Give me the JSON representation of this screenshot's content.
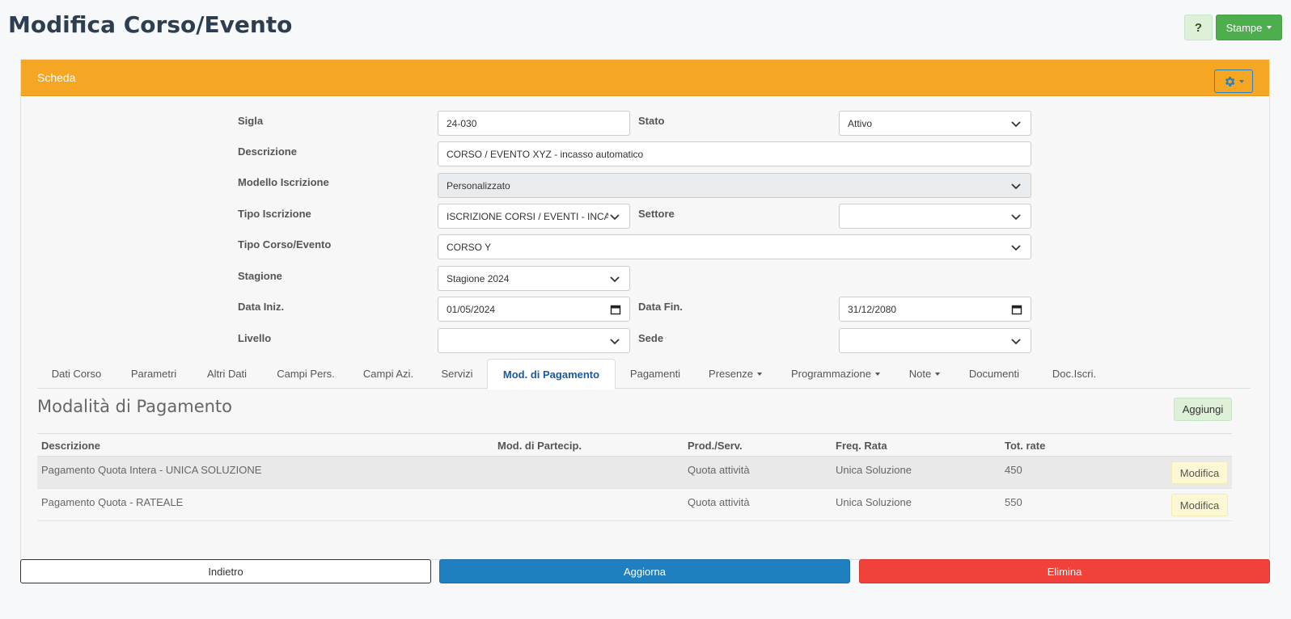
{
  "header": {
    "title": "Modifica Corso/Evento",
    "help_label": "?",
    "print_label": "Stampe"
  },
  "panel": {
    "title": "Scheda",
    "settings_icon": "gear-icon"
  },
  "form": {
    "sigla_label": "Sigla",
    "sigla_value": "24-030",
    "stato_label": "Stato",
    "stato_value": "Attivo",
    "descrizione_label": "Descrizione",
    "descrizione_value": "CORSO / EVENTO XYZ - incasso automatico",
    "modello_label": "Modello Iscrizione",
    "modello_value": "Personalizzato",
    "tipo_iscrizione_label": "Tipo Iscrizione",
    "tipo_iscrizione_value": "ISCRIZIONE CORSI / EVENTI - INCASSO AUTOMATICO",
    "settore_label": "Settore",
    "settore_value": "",
    "tipo_corso_label": "Tipo Corso/Evento",
    "tipo_corso_value": "CORSO Y",
    "stagione_label": "Stagione",
    "stagione_value": "Stagione 2024",
    "data_iniz_label": "Data Iniz.",
    "data_iniz_value": "01/05/2024",
    "data_fin_label": "Data Fin.",
    "data_fin_value": "31/12/2080",
    "livello_label": "Livello",
    "livello_value": "",
    "sede_label": "Sede",
    "sede_value": ""
  },
  "tabs": [
    {
      "label": "Dati Corso"
    },
    {
      "label": "Parametri"
    },
    {
      "label": "Altri Dati"
    },
    {
      "label": "Campi Pers."
    },
    {
      "label": "Campi Azi."
    },
    {
      "label": "Servizi"
    },
    {
      "label": "Mod. di Pagamento",
      "active": true
    },
    {
      "label": "Pagamenti"
    },
    {
      "label": "Presenze",
      "dropdown": true
    },
    {
      "label": "Programmazione",
      "dropdown": true
    },
    {
      "label": "Note",
      "dropdown": true
    },
    {
      "label": "Documenti"
    },
    {
      "label": "Doc.Iscri."
    }
  ],
  "payment": {
    "title": "Modalità di Pagamento",
    "add_label": "Aggiungi",
    "columns": [
      "Descrizione",
      "Mod. di Partecip.",
      "Prod./Serv.",
      "Freq. Rata",
      "Tot. rate"
    ],
    "rows": [
      {
        "descrizione": "Pagamento Quota Intera - UNICA SOLUZIONE",
        "partecip": "",
        "prod": "Quota attività",
        "freq": "Unica Soluzione",
        "tot": "450",
        "action": "Modifica"
      },
      {
        "descrizione": "Pagamento Quota - RATEALE",
        "partecip": "",
        "prod": "Quota attività",
        "freq": "Unica Soluzione",
        "tot": "550",
        "action": "Modifica"
      }
    ]
  },
  "footer": {
    "back_label": "Indietro",
    "update_label": "Aggiorna",
    "delete_label": "Elimina"
  },
  "colors": {
    "panel_header": "#f5a623",
    "primary": "#1f7fbf",
    "danger": "#f0413b",
    "success": "#4cae4c"
  }
}
